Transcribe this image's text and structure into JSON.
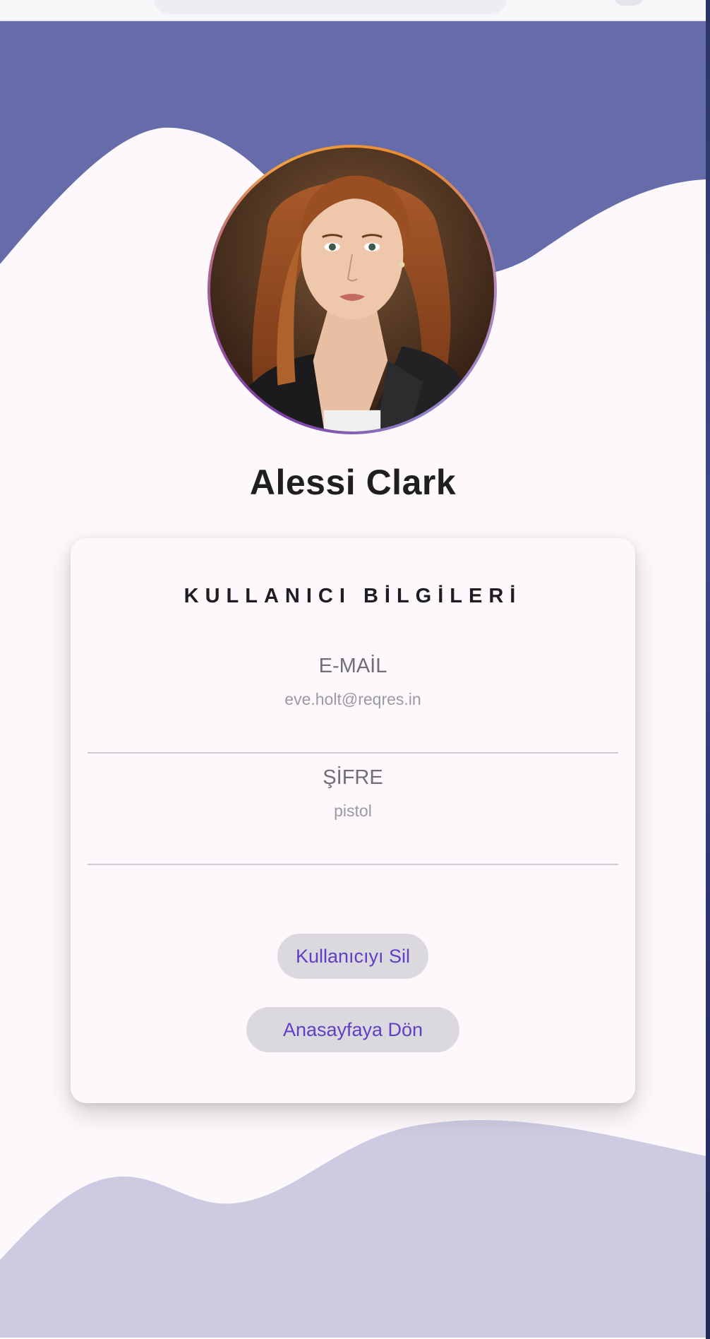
{
  "profile": {
    "name": "Alessi Clark"
  },
  "card": {
    "title": "KULLANICI BİLGİLERİ",
    "email_label": "E-MAİL",
    "email_value": "eve.holt@reqres.in",
    "password_label": "ŞİFRE",
    "password_value": "pistol"
  },
  "actions": {
    "delete_label": "Kullanıcıyı Sil",
    "home_label": "Anasayfaya Dön"
  },
  "colors": {
    "header_wave": "#666ca9",
    "footer_wave": "#cdcbe2",
    "background": "#fdf8fb",
    "button_text": "#5b40c8",
    "button_bg": "#dcd9de"
  }
}
